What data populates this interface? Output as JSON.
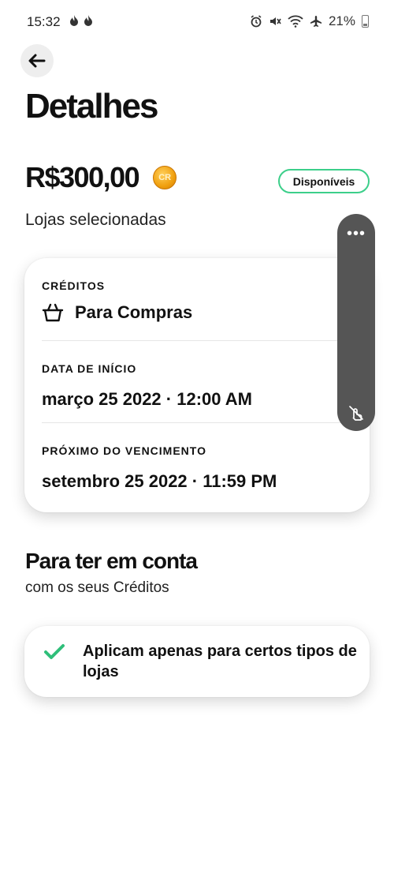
{
  "status_bar": {
    "time": "15:32",
    "battery_percent": "21%",
    "left_icons": [
      "flame-icon",
      "flame-icon"
    ],
    "right_icons": [
      "alarm-icon",
      "mute-icon",
      "wifi-icon",
      "airplane-icon",
      "battery-icon"
    ]
  },
  "header": {
    "title": "Detalhes"
  },
  "summary": {
    "amount": "R$300,00",
    "coin_label": "CR",
    "status_badge": "Disponíveis",
    "subtitle": "Lojas selecionadas"
  },
  "details": {
    "credits_label": "CRÉDITOS",
    "credits_value": "Para Compras",
    "start_label": "DATA DE INÍCIO",
    "start_value": "março 25 2022 · 12:00 AM",
    "expiry_label": "PRÓXIMO DO VENCIMENTO",
    "expiry_value": "setembro 25 2022 · 11:59 PM"
  },
  "overlay": {
    "menu_label": "•••"
  },
  "notes": {
    "title": "Para ter em conta",
    "subtitle": "com os seus Créditos",
    "items": [
      {
        "text": "Aplicam apenas para certos tipos de lojas"
      }
    ]
  },
  "colors": {
    "accent_green": "#3ccf8a",
    "check_green": "#2fbf7a",
    "coin_orange": "#f0a00f",
    "overlay_gray": "#555555"
  }
}
